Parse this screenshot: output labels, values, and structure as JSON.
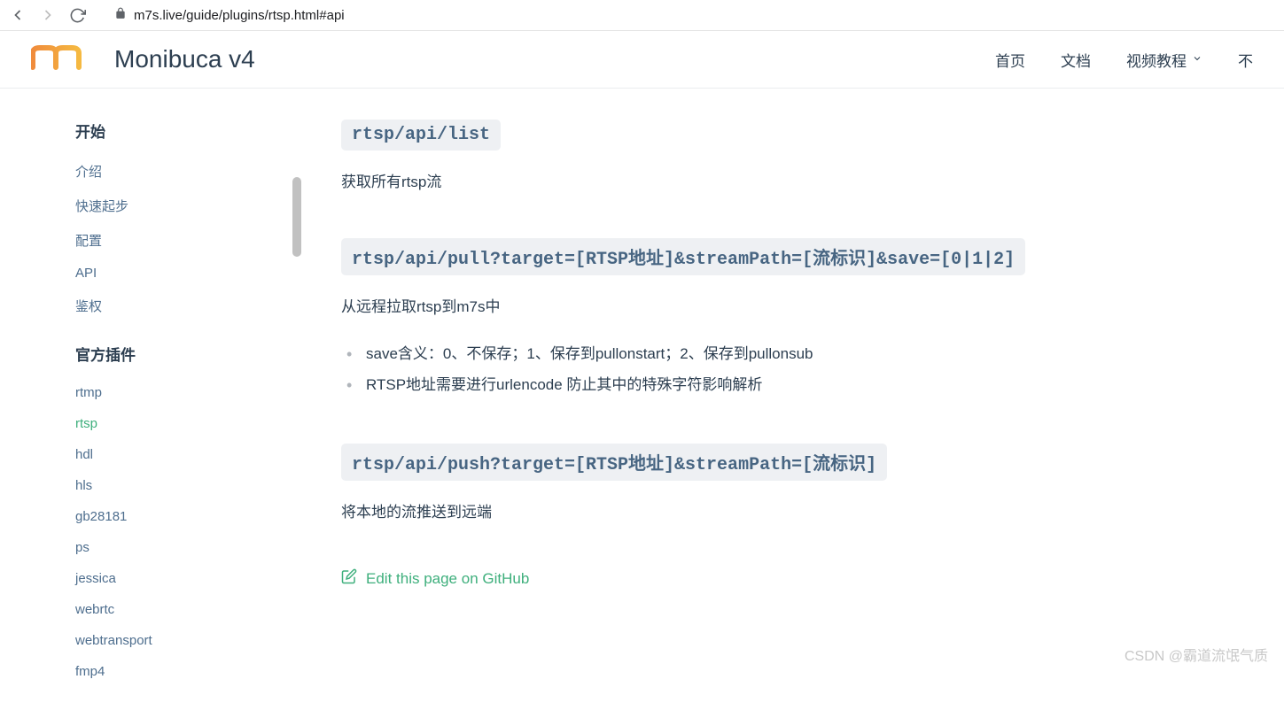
{
  "browser": {
    "url": "m7s.live/guide/plugins/rtsp.html#api"
  },
  "header": {
    "brand": "Monibuca v4",
    "nav": [
      {
        "label": "首页"
      },
      {
        "label": "文档"
      },
      {
        "label": "视频教程",
        "dropdown": true
      },
      {
        "label": "不"
      }
    ]
  },
  "sidebar": {
    "sections": [
      {
        "title": "开始",
        "items": [
          "介绍",
          "快速起步",
          "配置",
          "API",
          "鉴权"
        ]
      },
      {
        "title": "官方插件",
        "items": [
          "rtmp",
          "rtsp",
          "hdl",
          "hls",
          "gb28181",
          "ps",
          "jessica",
          "webrtc",
          "webtransport",
          "fmp4"
        ]
      }
    ],
    "active": "rtsp"
  },
  "content": {
    "blocks": [
      {
        "code": "rtsp/api/list",
        "desc": "获取所有rtsp流"
      },
      {
        "code": "rtsp/api/pull?target=[RTSP地址]&streamPath=[流标识]&save=[0|1|2]",
        "desc": "从远程拉取rtsp到m7s中",
        "bullets": [
          "save含义：0、不保存；1、保存到pullonstart；2、保存到pullonsub",
          "RTSP地址需要进行urlencode 防止其中的特殊字符影响解析"
        ]
      },
      {
        "code": "rtsp/api/push?target=[RTSP地址]&streamPath=[流标识]",
        "desc": "将本地的流推送到远端"
      }
    ],
    "edit_link": "Edit this page on GitHub"
  },
  "watermark": "CSDN @霸道流氓气质"
}
